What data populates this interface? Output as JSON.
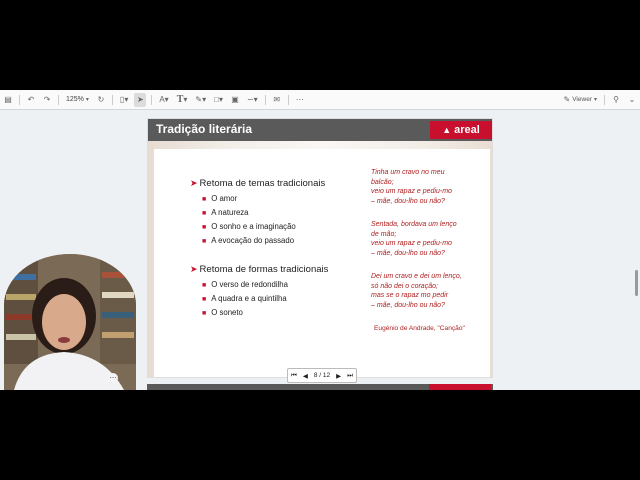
{
  "toolbar": {
    "zoom": "125%",
    "viewer_label": "Viewer"
  },
  "slide": {
    "title": "Tradição literária",
    "logo_text": "areal",
    "section_1": {
      "heading": "Retoma de temas tradicionais",
      "items": [
        "O amor",
        "A natureza",
        "O sonho e a imaginação",
        "A evocação do passado"
      ]
    },
    "section_2": {
      "heading": "Retoma de formas tradicionais",
      "items": [
        "O verso de redondilha",
        "A quadra e a quintilha",
        "O soneto"
      ]
    },
    "poem": {
      "stanza_1": [
        "Tinha um cravo no meu",
        "balcão;",
        "veio um rapaz e pediu-mo",
        "– mãe, dou-lho ou não?"
      ],
      "stanza_2": [
        "Sentada, bordava um lenço",
        "de mão;",
        "veio um rapaz e pediu-mo",
        "– mãe, dou-lho ou não?"
      ],
      "stanza_3": [
        "Dei um cravo e dei um lenço,",
        "só não dei o coração;",
        "mas se o rapaz mo pedir",
        "– mãe, dou-lho ou não?"
      ],
      "author": "Eugénio de Andrade, \"Canção\""
    }
  },
  "pager": {
    "page_label": "8 / 12"
  },
  "colors": {
    "brand_red": "#c8102e",
    "title_bar": "#5a5a5a",
    "poem_text": "#b01e1e"
  }
}
